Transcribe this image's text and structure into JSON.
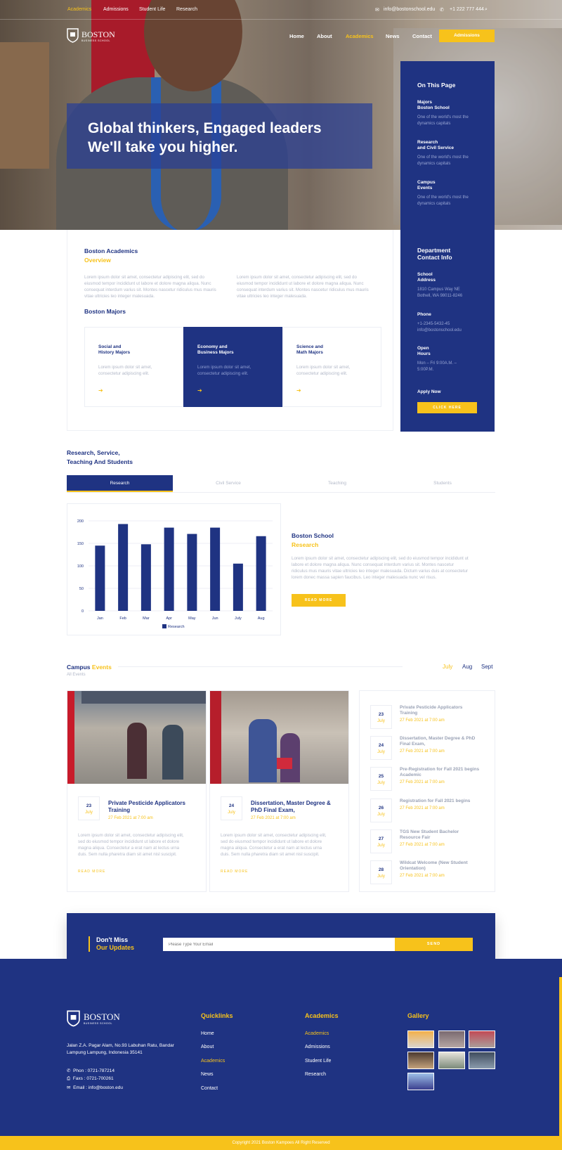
{
  "topbar": {
    "links": [
      "Academics",
      "Admissions",
      "Student Life",
      "Research"
    ],
    "email": "info@bostonschool.edu",
    "phone": "+1 222 777 444"
  },
  "brand": {
    "name": "BOSTON",
    "tagline": "BUSINESS SCHOOL"
  },
  "nav": {
    "items": [
      "Home",
      "About",
      "Academics",
      "News",
      "Contact"
    ],
    "cta": "Admissions"
  },
  "hero": {
    "line1": "Global thinkers, Engaged leaders",
    "line2": "We'll take you higher."
  },
  "side": {
    "title": "On This Page",
    "items": [
      {
        "l1": "Majors",
        "l2": "Boston School",
        "desc1": "One of the world's most the",
        "desc2": "dynamics capitals"
      },
      {
        "l1": "Research",
        "l2": "and Civil Service",
        "desc1": "One of the world's most the",
        "desc2": "dynamics capitals"
      },
      {
        "l1": "Campus",
        "l2": "Events",
        "desc1": "One of the world's most the",
        "desc2": "dynamics capitals"
      }
    ],
    "dept1": "Department",
    "dept2": "Contact Info",
    "addr_h1": "School",
    "addr_h2": "Address",
    "addr1": "1810 Campus Way NE",
    "addr2": "Bothell, WA 98011-8246",
    "phone_h": "Phone",
    "phone1": "+1-2345-5432-45",
    "phone2": "info@bostonschool.edu",
    "open_h1": "Open",
    "open_h2": "Hours",
    "open1": "Mon – Fri 9:00A.M. –",
    "open2": "5:00P.M.",
    "apply": "Apply Now",
    "apply_btn": "CLICK HERE"
  },
  "academics": {
    "title": "Boston Academics",
    "subtitle": "Overview",
    "para_l": [
      "Lorem ipsum dolor sit amet, consectetur adipiscing elit, sed do",
      "eiusmod tempor incididunt ut labore et dolore magna aliqua. Nunc",
      "consequat interdum varius sit. Montes nascetur ridiculus mus mauris",
      "vitae ultricies leo integer malesuada."
    ],
    "para_r": [
      "Lorem ipsum dolor sit amet, consectetur adipiscing elit, sed do",
      "eiusmod tempor incididunt ut labore et dolore magna aliqua. Nunc",
      "consequat interdum varius sit. Montes nascetur ridiculus mus mauris",
      "vitae ultricies leo integer malesuada."
    ],
    "majors_title": "Boston Majors",
    "majors": [
      {
        "l1": "Social and",
        "l2": "History Majors",
        "d1": "Lorem ipsum dolor sit amet,",
        "d2": "consectetur adipiscing elit."
      },
      {
        "l1": "Economy and",
        "l2": "Business Majors",
        "d1": "Lorem ipsum dolor sit amet,",
        "d2": "consectetur adipiscing elit."
      },
      {
        "l1": "Science and",
        "l2": "Math Majors",
        "d1": "Lorem ipsum dolor sit amet,",
        "d2": "consectetur adipiscing elit."
      }
    ]
  },
  "research": {
    "title1": "Research, Service,",
    "title2": "Teaching And Students",
    "tabs": [
      "Research",
      "Civil Service",
      "Teaching",
      "Students"
    ],
    "school": "Boston School",
    "sub": "Research",
    "para": [
      "Lorem ipsum dolor sit amet, consectetur adipiscing elit, sed do eiusmod tempor incididunt ut",
      "labore et dolore magna aliqua. Nunc consequat interdum varius sit. Montes nascetur",
      "ridiculus mus mauris vitae ultricies leo integer malesuada. Dictum varius duis at consectetur",
      "lorem donec massa sapien faucibus. Leo integer malesuada nunc vel risus."
    ],
    "btn": "READ MORE"
  },
  "chart_data": {
    "type": "bar",
    "categories": [
      "Jan",
      "Feb",
      "Mar",
      "Apr",
      "May",
      "Jun",
      "July",
      "Aug"
    ],
    "series": [
      {
        "name": "Research",
        "values": [
          145,
          193,
          148,
          185,
          171,
          185,
          105,
          166
        ]
      }
    ],
    "ylim": [
      0,
      200
    ],
    "yticks": [
      0,
      50,
      100,
      150,
      200
    ],
    "legend": "bottom",
    "grid": true,
    "color": "#1f3382"
  },
  "events": {
    "t1": "Campus",
    "t2": "Events",
    "sub": "All Events",
    "months": [
      "July",
      "Aug",
      "Sept"
    ],
    "cards": [
      {
        "day": "23",
        "month": "July",
        "title1": "Private Pesticide Applicators",
        "title2": "Training",
        "time": "27 Feb 2021 at 7:00 am",
        "p": [
          "Lorem ipsum dolor sit amet, consectetur adipiscing elit,",
          "sed do eiusmod tempor incididunt ut labore et dolore",
          "magna aliqua. Consectetur a erat nam at lectus urna",
          "duis. Sem nulla pharetra diam sit amet nisl suscipit."
        ],
        "more": "READ MORE"
      },
      {
        "day": "24",
        "month": "July",
        "title1": "Dissertation, Master Degree &",
        "title2": "PhD Final Exam,",
        "time": "27 Feb 2021 at 7:00 am",
        "p": [
          "Lorem ipsum dolor sit amet, consectetur adipiscing elit,",
          "sed do eiusmod tempor incididunt ut labore et dolore",
          "magna aliqua. Consectetur a erat nam at lectus urna",
          "duis. Sem nulla pharetra diam sit amet nisl suscipit."
        ],
        "more": "READ MORE"
      }
    ],
    "list": [
      {
        "day": "23",
        "month": "July",
        "t1": "Private Pesticide Applicators",
        "t2": "Training",
        "time": "27 Feb 2021 at 7:00 am"
      },
      {
        "day": "24",
        "month": "July",
        "t1": "Dissertation, Master Degree & PhD",
        "t2": "Final Exam,",
        "time": "27 Feb 2021 at 7:00 am"
      },
      {
        "day": "25",
        "month": "July",
        "t1": "Pre-Registration for Fall 2021 begins",
        "t2": "Academic",
        "time": "27 Feb 2021 at 7:00 am"
      },
      {
        "day": "26",
        "month": "July",
        "t1": "Registration for Fall 2021 begins",
        "t2": "",
        "time": "27 Feb 2021 at 7:00 am"
      },
      {
        "day": "27",
        "month": "July",
        "t1": "TGS New Student Bachelor",
        "t2": "Resource Fair",
        "time": "27 Feb 2021 at 7:00 am"
      },
      {
        "day": "28",
        "month": "July",
        "t1": "Wildcat Welcome (New Student",
        "t2": "Orientation)",
        "time": "27 Feb 2021 at 7:00 am"
      }
    ]
  },
  "newsletter": {
    "l1": "Don't Miss",
    "l2": "Our Updates",
    "placeholder": "Please Type Your Email",
    "btn": "SEND"
  },
  "footer": {
    "address1": "Jalan Z.A. Pagar Alam, No.93 Labuhan Ratu, Bandar",
    "address2": "Lampung Lampung, Indonesia 35141",
    "phone": "Phon : 0721-787214",
    "fax": "Faxs : 0721-700261",
    "email": "Email : info@boston.edu",
    "quick_h": "Quicklinks",
    "quick": [
      "Home",
      "About",
      "Academics",
      "News",
      "Contact"
    ],
    "acad_h": "Academics",
    "acad": [
      "Academics",
      "Admissions",
      "Student Life",
      "Research"
    ],
    "gallery_h": "Gallery",
    "copyright": "Copyright 2021 Boston Kampoes All Right Reserved"
  },
  "colors": {
    "navy": "#1f3382",
    "yellow": "#f7c21b"
  }
}
